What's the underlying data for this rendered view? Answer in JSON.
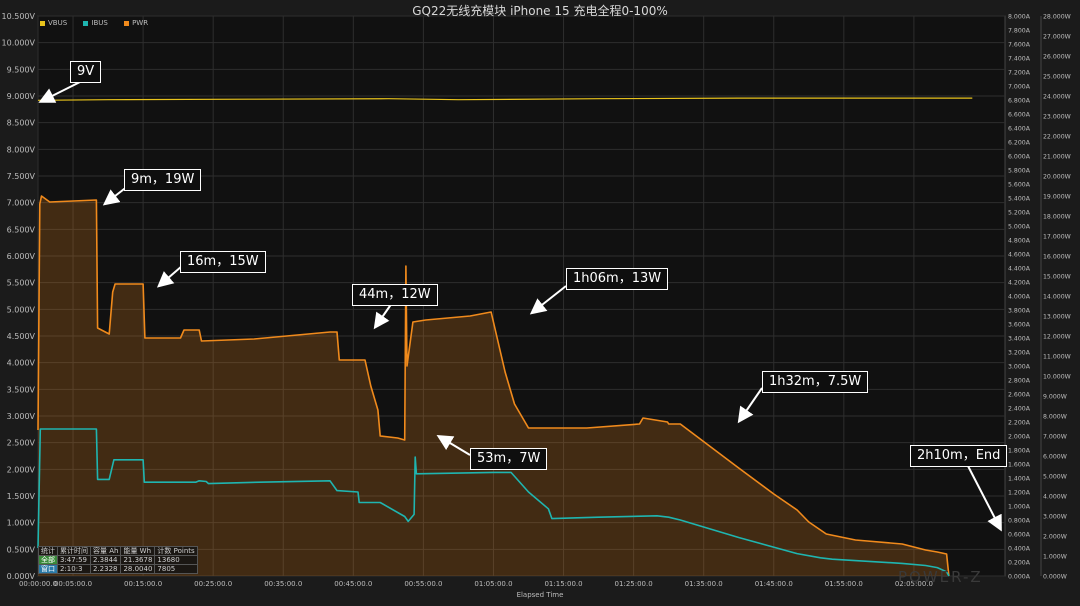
{
  "page": {
    "title": "GQ22无线充模块 iPhone 15 充电全程0-100%"
  },
  "legend": [
    {
      "name": "VBUS",
      "color": "#e8c31c"
    },
    {
      "name": "IBUS",
      "color": "#1fb5b0"
    },
    {
      "name": "PWR",
      "color": "#f08a1c"
    }
  ],
  "annotations": [
    {
      "text": "9V"
    },
    {
      "text": "9m，19W"
    },
    {
      "text": "16m，15W"
    },
    {
      "text": "44m，12W"
    },
    {
      "text": "53m，7W"
    },
    {
      "text": "1h06m，13W"
    },
    {
      "text": "1h32m，7.5W"
    },
    {
      "text": "2h10m，End"
    }
  ],
  "stats": {
    "headers": [
      "统计",
      "累计时间",
      "容量 Ah",
      "能量 Wh",
      "计数 Points"
    ],
    "rows": [
      [
        "全部",
        "3:47:59",
        "2.3844",
        "21.3678",
        "13680"
      ],
      [
        "窗口",
        "2:10:3",
        "2.2328",
        "28.0040",
        "7805"
      ]
    ]
  },
  "brand": "POWER-Z",
  "chart_data": {
    "type": "line",
    "title": "GQ22无线充模块 iPhone 15 充电全程0-100%",
    "xlabel": "Elapsed Time",
    "xlim": [
      0,
      8280
    ],
    "x_ticks": [
      {
        "v": 0,
        "label": "00:00:00.0"
      },
      {
        "v": 300,
        "label": "00:05:00.0"
      },
      {
        "v": 900,
        "label": "00:15:00.0"
      },
      {
        "v": 1500,
        "label": "00:25:00.0"
      },
      {
        "v": 2100,
        "label": "00:35:00.0"
      },
      {
        "v": 2700,
        "label": "00:45:00.0"
      },
      {
        "v": 3300,
        "label": "00:55:00.0"
      },
      {
        "v": 3900,
        "label": "01:05:00.0"
      },
      {
        "v": 4500,
        "label": "01:15:00.0"
      },
      {
        "v": 5100,
        "label": "01:25:00.0"
      },
      {
        "v": 5700,
        "label": "01:35:00.0"
      },
      {
        "v": 6300,
        "label": "01:45:00.0"
      },
      {
        "v": 6900,
        "label": "01:55:00.0"
      },
      {
        "v": 7500,
        "label": "02:05:00.0"
      }
    ],
    "y_left": {
      "label": "VBUS",
      "unit": "V",
      "min": 0,
      "max": 10.5,
      "step": 0.5,
      "decimals": 3
    },
    "y_right1": {
      "label": "IBUS",
      "unit": "A",
      "min": 0,
      "max": 8,
      "step": 0.2,
      "decimals": 3
    },
    "y_right2": {
      "label": "PWR",
      "unit": "W",
      "min": 0,
      "max": 28,
      "step": 1,
      "decimals": 3
    },
    "grid": true,
    "legend_position": "top-left",
    "series": [
      {
        "name": "VBUS",
        "axis": "left",
        "color": "#e8c31c",
        "points": [
          [
            0,
            8.92
          ],
          [
            600,
            8.93
          ],
          [
            1800,
            8.94
          ],
          [
            3000,
            8.95
          ],
          [
            3600,
            8.93
          ],
          [
            4800,
            8.95
          ],
          [
            6000,
            8.96
          ],
          [
            7200,
            8.96
          ],
          [
            8000,
            8.96
          ]
        ]
      },
      {
        "name": "IBUS",
        "axis": "right1",
        "color": "#1fb5b0",
        "points": [
          [
            0,
            0.4
          ],
          [
            20,
            2.1
          ],
          [
            100,
            2.1
          ],
          [
            500,
            2.1
          ],
          [
            510,
            1.38
          ],
          [
            610,
            1.38
          ],
          [
            650,
            1.66
          ],
          [
            900,
            1.66
          ],
          [
            910,
            1.34
          ],
          [
            1350,
            1.34
          ],
          [
            1380,
            1.36
          ],
          [
            1440,
            1.35
          ],
          [
            1460,
            1.32
          ],
          [
            1900,
            1.34
          ],
          [
            2500,
            1.36
          ],
          [
            2560,
            1.22
          ],
          [
            2740,
            1.2
          ],
          [
            2750,
            1.05
          ],
          [
            2930,
            1.05
          ],
          [
            3140,
            0.85
          ],
          [
            3170,
            0.78
          ],
          [
            3220,
            0.88
          ],
          [
            3230,
            1.7
          ],
          [
            3240,
            1.46
          ],
          [
            3900,
            1.48
          ],
          [
            4050,
            1.48
          ],
          [
            4200,
            1.2
          ],
          [
            4370,
            0.96
          ],
          [
            4400,
            0.82
          ],
          [
            4800,
            0.84
          ],
          [
            5300,
            0.86
          ],
          [
            5400,
            0.84
          ],
          [
            5500,
            0.8
          ],
          [
            6000,
            0.55
          ],
          [
            6500,
            0.32
          ],
          [
            6700,
            0.26
          ],
          [
            6800,
            0.24
          ],
          [
            7400,
            0.18
          ],
          [
            7600,
            0.15
          ],
          [
            7700,
            0.12
          ],
          [
            7780,
            0.06
          ],
          [
            7800,
            0.0
          ]
        ]
      },
      {
        "name": "PWR",
        "axis": "right2",
        "color": "#f08a1c",
        "points": [
          [
            0,
            7.3
          ],
          [
            15,
            18.6
          ],
          [
            30,
            19.0
          ],
          [
            100,
            18.7
          ],
          [
            500,
            18.8
          ],
          [
            510,
            12.4
          ],
          [
            610,
            12.1
          ],
          [
            640,
            14.2
          ],
          [
            660,
            14.6
          ],
          [
            900,
            14.6
          ],
          [
            915,
            11.9
          ],
          [
            1220,
            11.9
          ],
          [
            1250,
            12.3
          ],
          [
            1380,
            12.3
          ],
          [
            1400,
            11.75
          ],
          [
            1850,
            11.85
          ],
          [
            2500,
            12.2
          ],
          [
            2560,
            12.2
          ],
          [
            2580,
            10.8
          ],
          [
            2800,
            10.8
          ],
          [
            2850,
            9.5
          ],
          [
            2910,
            8.3
          ],
          [
            2930,
            7.0
          ],
          [
            3080,
            6.9
          ],
          [
            3140,
            6.8
          ],
          [
            3150,
            15.5
          ],
          [
            3160,
            10.5
          ],
          [
            3210,
            12.7
          ],
          [
            3320,
            12.8
          ],
          [
            3700,
            13.0
          ],
          [
            3880,
            13.2
          ],
          [
            4000,
            10.2
          ],
          [
            4080,
            8.6
          ],
          [
            4200,
            7.4
          ],
          [
            4700,
            7.4
          ],
          [
            5150,
            7.6
          ],
          [
            5180,
            7.9
          ],
          [
            5390,
            7.7
          ],
          [
            5400,
            7.6
          ],
          [
            5500,
            7.6
          ],
          [
            6000,
            5.4
          ],
          [
            6300,
            4.1
          ],
          [
            6500,
            3.3
          ],
          [
            6600,
            2.7
          ],
          [
            6750,
            2.1
          ],
          [
            7000,
            1.8
          ],
          [
            7400,
            1.6
          ],
          [
            7600,
            1.3
          ],
          [
            7700,
            1.2
          ],
          [
            7780,
            1.1
          ],
          [
            7800,
            0.0
          ]
        ]
      }
    ]
  }
}
